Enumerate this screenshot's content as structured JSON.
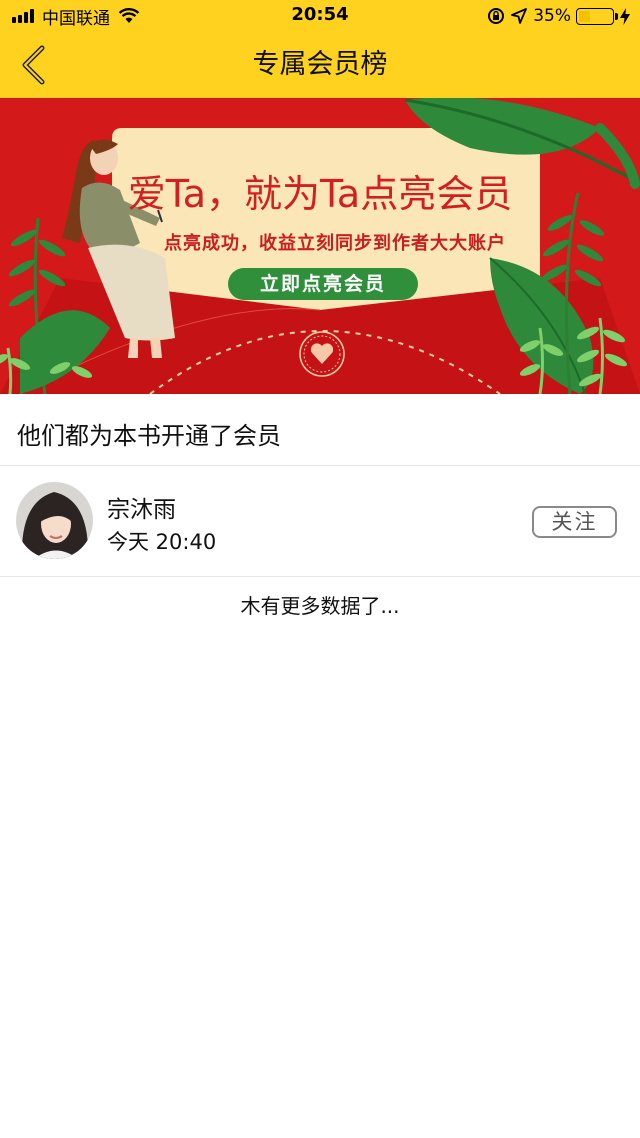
{
  "status_bar": {
    "carrier": "中国联通",
    "time": "20:54",
    "battery_percent_text": "35%",
    "battery_level": 0.35,
    "icons": [
      "signal-icon",
      "wifi-icon",
      "orientation-lock-icon",
      "location-icon",
      "battery-icon",
      "charging-icon"
    ]
  },
  "nav": {
    "title": "专属会员榜",
    "back_icon": "chevron-left-icon"
  },
  "banner": {
    "headline": "爱Ta，就为Ta点亮会员",
    "subtitle": "点亮成功，收益立刻同步到作者大大账户",
    "cta": "立即点亮会员",
    "colors": {
      "background": "#d4191b",
      "card": "#fbe6b8",
      "accent_green": "#2f8f3a"
    }
  },
  "section": {
    "title": "他们都为本书开通了会员"
  },
  "members": [
    {
      "name": "宗沐雨",
      "time": "今天 20:40",
      "follow_label": "关注"
    }
  ],
  "footer": {
    "no_more_text": "木有更多数据了..."
  },
  "colors": {
    "header_yellow": "#ffd21f",
    "divider": "#e6e6e6"
  }
}
